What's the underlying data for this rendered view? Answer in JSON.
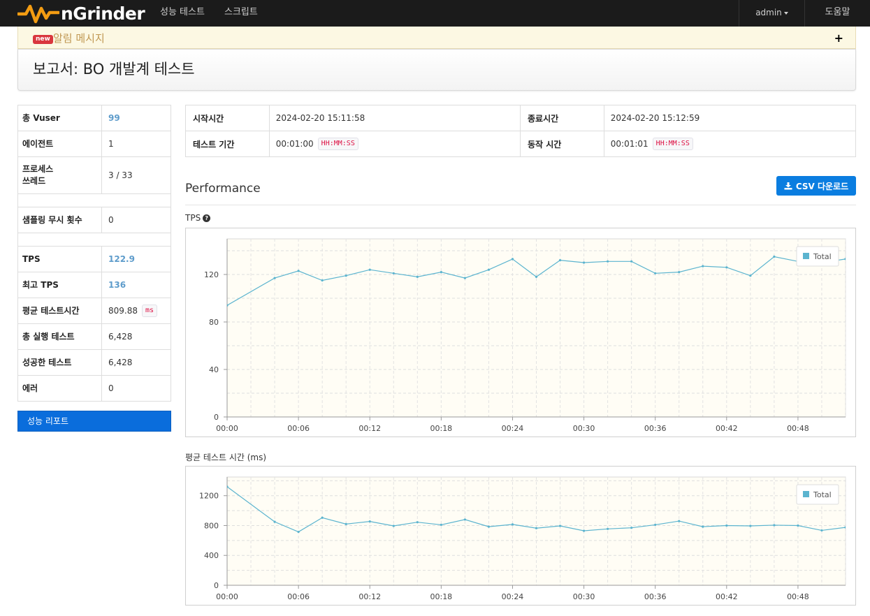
{
  "nav": {
    "brand": "nGrinder",
    "items": [
      "성능 테스트",
      "스크립트"
    ],
    "user": "admin",
    "help": "도움말"
  },
  "alert": {
    "badge": "new",
    "text": "알림 메시지",
    "toggle": "+"
  },
  "report": {
    "title": "보고서: BO 개발계 테스트"
  },
  "summary": [
    {
      "label": "총 Vuser",
      "value": "99",
      "highlight": true
    },
    {
      "label": "에이전트",
      "value": "1",
      "highlight": false
    },
    {
      "label": "프로세스\n쓰레드",
      "value": "3 / 33",
      "highlight": false
    },
    {
      "label": "샘플링 무시 횟수",
      "value": "0",
      "highlight": false
    },
    {
      "label": "TPS",
      "value": "122.9",
      "highlight": true
    },
    {
      "label": "최고 TPS",
      "value": "136",
      "highlight": true
    },
    {
      "label": "평균 테스트시간",
      "value": "809.88",
      "unit": "ms",
      "highlight": false
    },
    {
      "label": "총 실행 테스트",
      "value": "6,428",
      "highlight": false
    },
    {
      "label": "성공한 테스트",
      "value": "6,428",
      "highlight": false
    },
    {
      "label": "에러",
      "value": "0",
      "highlight": false
    }
  ],
  "report_button": "성능 리포트",
  "times": {
    "start_label": "시작시간",
    "start_value": "2024-02-20 15:11:58",
    "end_label": "종료시간",
    "end_value": "2024-02-20 15:12:59",
    "duration_label": "테스트 기간",
    "duration_value": "00:01:00",
    "duration_unit": "HH:MM:SS",
    "run_label": "동작 시간",
    "run_value": "00:01:01",
    "run_unit": "HH:MM:SS"
  },
  "performance": {
    "title": "Performance",
    "csv_button": "CSV 다운로드"
  },
  "colors": {
    "series": "#5bb4cf",
    "plot_bg": "#fffdf5",
    "primary_button": "#0a7de0"
  },
  "chart_data": [
    {
      "type": "line",
      "title": "TPS",
      "x": [
        "00:00",
        "00:04",
        "00:06",
        "00:08",
        "00:10",
        "00:12",
        "00:14",
        "00:16",
        "00:18",
        "00:20",
        "00:22",
        "00:24",
        "00:26",
        "00:28",
        "00:30",
        "00:32",
        "00:34",
        "00:36",
        "00:38",
        "00:40",
        "00:42",
        "00:44",
        "00:46",
        "00:48",
        "00:50",
        "00:52"
      ],
      "xticks": [
        "00:00",
        "00:06",
        "00:12",
        "00:18",
        "00:24",
        "00:30",
        "00:36",
        "00:42",
        "00:48"
      ],
      "yticks": [
        0,
        40,
        80,
        120
      ],
      "ylim": [
        0,
        150
      ],
      "xlim_seconds": [
        0,
        52
      ],
      "series": [
        {
          "name": "Total",
          "values": [
            94,
            117,
            123,
            115,
            119,
            124,
            121,
            118,
            122,
            117,
            124,
            133,
            118,
            132,
            130,
            131,
            131,
            121,
            122,
            127,
            126,
            119,
            135,
            131,
            130,
            133
          ]
        }
      ],
      "legend": "top-right",
      "grid": true
    },
    {
      "type": "line",
      "title": "평균 테스트 시간 (ms)",
      "x": [
        "00:00",
        "00:04",
        "00:06",
        "00:08",
        "00:10",
        "00:12",
        "00:14",
        "00:16",
        "00:18",
        "00:20",
        "00:22",
        "00:24",
        "00:26",
        "00:28",
        "00:30",
        "00:32",
        "00:34",
        "00:36",
        "00:38",
        "00:40",
        "00:42",
        "00:44",
        "00:46",
        "00:48",
        "00:50",
        "00:52"
      ],
      "xticks": [
        "00:00",
        "00:06",
        "00:12",
        "00:18",
        "00:24",
        "00:30",
        "00:36",
        "00:42",
        "00:48"
      ],
      "yticks": [
        0,
        400,
        800,
        1200
      ],
      "ylim": [
        0,
        1450
      ],
      "xlim_seconds": [
        0,
        52
      ],
      "series": [
        {
          "name": "Total",
          "values": [
            1320,
            850,
            715,
            905,
            820,
            855,
            795,
            845,
            810,
            880,
            785,
            815,
            765,
            795,
            730,
            755,
            770,
            810,
            860,
            785,
            800,
            795,
            805,
            800,
            735,
            775
          ]
        }
      ],
      "legend": "top-right",
      "grid": true
    }
  ]
}
